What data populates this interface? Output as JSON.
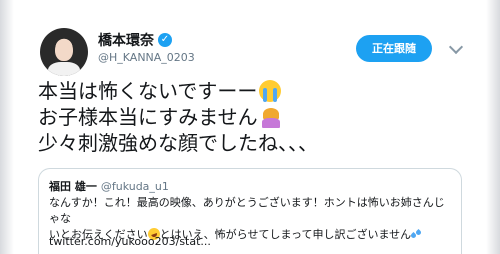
{
  "author": {
    "display_name": "橋本環奈",
    "handle": "@H_KANNA_0203",
    "verified_mark": "✓"
  },
  "follow_button": {
    "label": "正在跟随"
  },
  "tweet": {
    "lines": [
      "本当は怖くないですーー",
      "お子様本当にすみません",
      "少々刺激強めな顔でしたね、、、"
    ]
  },
  "quoted_tweet": {
    "display_name": "福田 雄一",
    "handle": "@fukuda_u1",
    "text_line1": "なんすか！これ！最高の映像、ありがとうございます！ホントは怖いお姉さんじゃな",
    "text_line2a": "いとお伝えください",
    "text_line2b": "とはいえ、怖がらせてしまって申し訳ございません",
    "link": "twitter.com/yukooo203/stat..."
  },
  "icons": {
    "avatar": "avatar",
    "verified": "verified-badge-icon",
    "caret": "chevron-down-icon",
    "emoji_1": "loudly-crying-face-emoji",
    "emoji_2": "person-bowing-emoji",
    "emoji_3": "rolling-on-floor-laughing-emoji",
    "emoji_4": "sweat-droplets-emoji"
  },
  "colors": {
    "accent": "#1da1f2",
    "text": "#14171a",
    "muted": "#657786",
    "border": "#cfd9de"
  }
}
